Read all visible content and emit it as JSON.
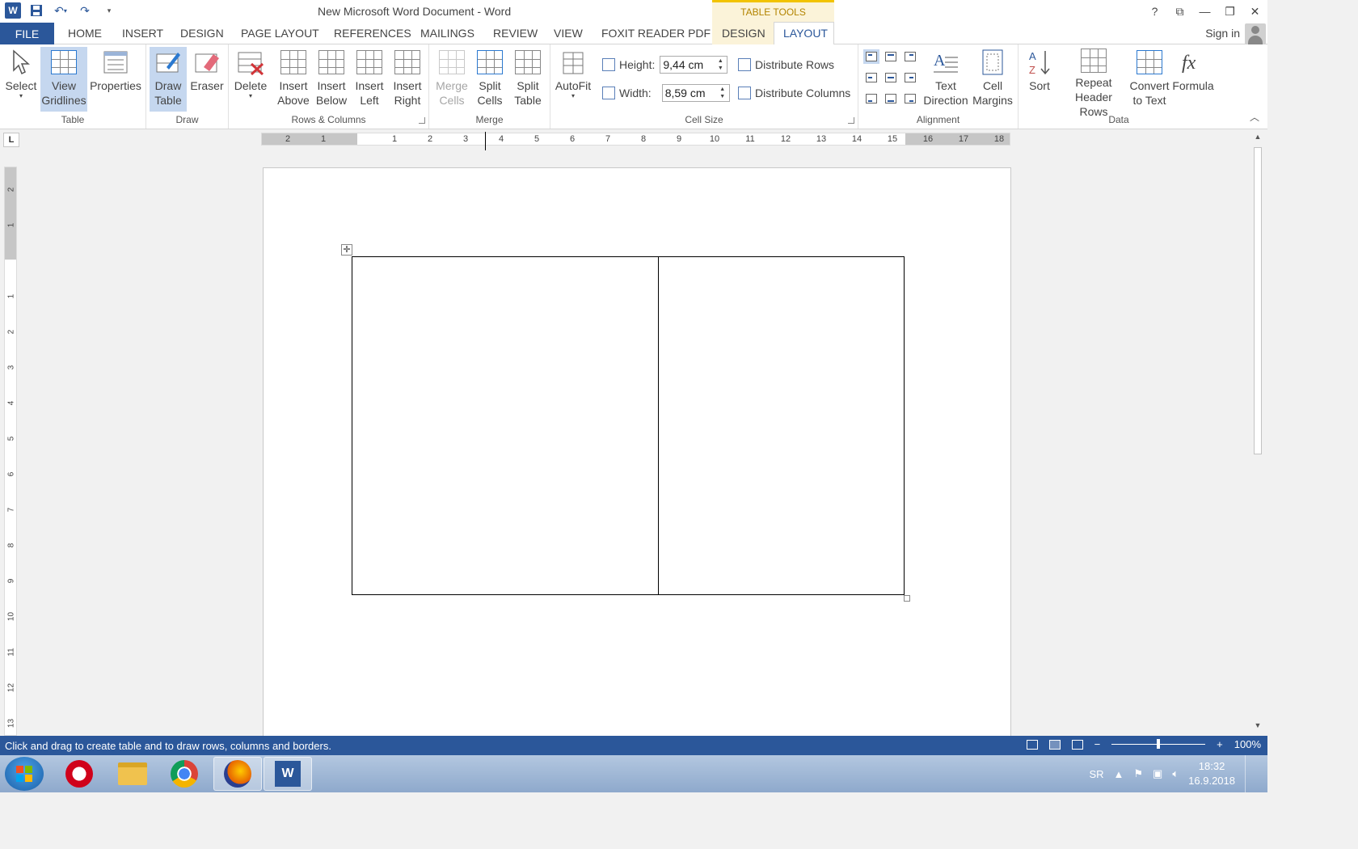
{
  "window": {
    "title": "New Microsoft Word Document - Word",
    "contextual_group": "TABLE TOOLS",
    "controls": [
      "?",
      "⧉",
      "—",
      "❐",
      "✕"
    ]
  },
  "qat": {
    "app_icon": "W",
    "save_icon": "save-icon",
    "undo_icon": "undo-icon",
    "redo_icon": "redo-icon",
    "customize_icon": "customize-qat-icon"
  },
  "tabs": {
    "file": "FILE",
    "home": "HOME",
    "insert": "INSERT",
    "design": "DESIGN",
    "page_layout": "PAGE LAYOUT",
    "references": "REFERENCES",
    "mailings": "MAILINGS",
    "review": "REVIEW",
    "view": "VIEW",
    "foxit": "FOXIT READER PDF",
    "table_design": "DESIGN",
    "table_layout": "LAYOUT",
    "signin": "Sign in"
  },
  "ribbon": {
    "table_group": {
      "label": "Table",
      "select": "Select",
      "view_gridlines_1": "View",
      "view_gridlines_2": "Gridlines",
      "properties": "Properties"
    },
    "draw_group": {
      "label": "Draw",
      "draw_table_1": "Draw",
      "draw_table_2": "Table",
      "eraser": "Eraser"
    },
    "rows_group": {
      "label": "Rows & Columns",
      "delete": "Delete",
      "insert_above_1": "Insert",
      "insert_above_2": "Above",
      "insert_below_1": "Insert",
      "insert_below_2": "Below",
      "insert_left_1": "Insert",
      "insert_left_2": "Left",
      "insert_right_1": "Insert",
      "insert_right_2": "Right"
    },
    "merge_group": {
      "label": "Merge",
      "merge_cells_1": "Merge",
      "merge_cells_2": "Cells",
      "split_cells_1": "Split",
      "split_cells_2": "Cells",
      "split_table_1": "Split",
      "split_table_2": "Table"
    },
    "cellsize_group": {
      "label": "Cell Size",
      "autofit": "AutoFit",
      "height_label": "Height:",
      "height_value": "9,44 cm",
      "width_label": "Width:",
      "width_value": "8,59 cm",
      "distribute_rows": "Distribute Rows",
      "distribute_columns": "Distribute Columns"
    },
    "alignment_group": {
      "label": "Alignment",
      "text_direction_1": "Text",
      "text_direction_2": "Direction",
      "cell_margins_1": "Cell",
      "cell_margins_2": "Margins"
    },
    "data_group": {
      "label": "Data",
      "sort": "Sort",
      "repeat_header_1": "Repeat",
      "repeat_header_2": "Header Rows",
      "convert_1": "Convert",
      "convert_2": "to Text",
      "formula": "Formula"
    }
  },
  "ruler": {
    "corner": "L",
    "h_numbers": [
      "2",
      "1",
      "1",
      "2",
      "3",
      "4",
      "5",
      "6",
      "7",
      "8",
      "9",
      "10",
      "11",
      "12",
      "13",
      "14",
      "15",
      "16",
      "17",
      "18"
    ],
    "v_numbers": [
      "2",
      "1",
      "1",
      "2",
      "3",
      "4",
      "5",
      "6",
      "7",
      "8",
      "9",
      "10",
      "11",
      "12",
      "13"
    ]
  },
  "status": {
    "message": "Click and drag to create table and to draw rows, columns and borders.",
    "zoom": "100%",
    "zoom_level_fraction": 0.5
  },
  "taskbar": {
    "apps": [
      "opera-icon",
      "file-explorer-icon",
      "chrome-icon",
      "firefox-icon",
      "word-icon"
    ],
    "language": "SR",
    "time": "18:32",
    "date": "16.9.2018"
  },
  "colors": {
    "accent": "#2b579a",
    "contextual": "#fbf3d9",
    "selected": "#c5d7ef"
  }
}
